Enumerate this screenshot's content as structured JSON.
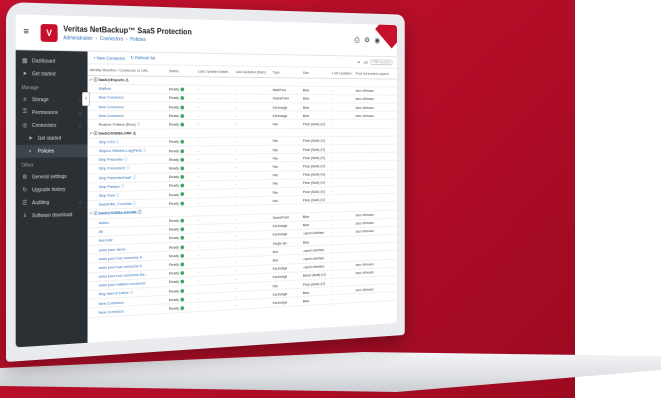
{
  "app": {
    "title": "Veritas NetBackup™ SaaS Protection",
    "breadcrumb": [
      "Administration",
      "Connectors",
      "Policies"
    ],
    "logo_label": "V",
    "colors": {
      "brand": "#c8102e",
      "link": "#2a6db5",
      "ok": "#3aa55d"
    }
  },
  "sidebar": {
    "items": [
      {
        "icon": "dashboard-icon",
        "glyph": "▦",
        "label": "Dashboard"
      },
      {
        "icon": "rocket-icon",
        "glyph": "➤",
        "label": "Get started"
      },
      {
        "icon": "",
        "glyph": "",
        "label": "Manage",
        "section": true
      },
      {
        "icon": "storage-icon",
        "glyph": "≡",
        "label": "Storage"
      },
      {
        "icon": "permissions-icon",
        "glyph": "⚿",
        "label": "Permissions"
      },
      {
        "icon": "connectors-icon",
        "glyph": "◎",
        "label": "Connectors"
      },
      {
        "icon": "rocket-icon",
        "glyph": "➤",
        "label": "Get started",
        "sub": true
      },
      {
        "icon": "policies-icon",
        "glyph": "◐",
        "label": "Policies",
        "sub": true,
        "active": true
      },
      {
        "icon": "",
        "glyph": "",
        "label": "Other",
        "section": true
      },
      {
        "icon": "settings-icon",
        "glyph": "⚙",
        "label": "General settings"
      },
      {
        "icon": "upgrade-icon",
        "glyph": "↻",
        "label": "Upgrade history"
      },
      {
        "icon": "auditing-icon",
        "glyph": "☰",
        "label": "Auditing"
      },
      {
        "icon": "software-icon",
        "glyph": "⤓",
        "label": "Software download"
      }
    ]
  },
  "toolbar": {
    "new_connector": "+ New Connector",
    "refresh": "Refresh list",
    "filter_label": "All",
    "search_placeholder": "Filter by name"
  },
  "table": {
    "headers": [
      "Identity Machine / Connector or URL",
      "Status",
      "Last Updated (date)",
      "Last Updated (stats)",
      "Type",
      "Size",
      "Last Updated",
      "Post Scheduled capture"
    ],
    "rows": [
      {
        "kind": "group",
        "name": "✓ ⓒ SaaS@Exports ⚠"
      },
      {
        "kind": "item",
        "name": "Mailbox",
        "status": "Ready",
        "c3": "-",
        "c4": "-",
        "type": "Mail/Prox",
        "size": "Blue",
        "c7": "-",
        "c8": "sec/-/#/hours"
      },
      {
        "kind": "item",
        "name": "New Connector",
        "status": "Ready",
        "c3": "-",
        "c4": "-",
        "type": "SharePoint",
        "size": "Blue",
        "c7": "-",
        "c8": "sec/-/#/hours"
      },
      {
        "kind": "item",
        "name": "New Connector",
        "status": "Ready",
        "c3": "-",
        "c4": "-",
        "type": "Exchange",
        "size": "Blue",
        "c7": "-",
        "c8": "sec/-/#/hours"
      },
      {
        "kind": "item",
        "name": "New Connector",
        "status": "Ready",
        "c3": "-",
        "c4": "-",
        "type": "Exchange",
        "size": "Blue",
        "c7": "-",
        "c8": "sec/-/#/hours"
      },
      {
        "kind": "item",
        "dark": true,
        "name": "Restore Folders (Root) ⓘ",
        "status": "Ready",
        "c3": "-",
        "c4": "-",
        "type": "File",
        "size": "Price (Bulk) (G)",
        "c7": "-",
        "c8": ""
      },
      {
        "kind": "group",
        "name": "✓ ⓒ SaaS@GIS/Ba.ORK ⚠"
      },
      {
        "kind": "item",
        "name": "Strip OTS ⓘ",
        "status": "Ready",
        "c3": "-",
        "c4": "-",
        "type": "File",
        "size": "Price (Bulk) (G)",
        "c7": "-",
        "c8": ""
      },
      {
        "kind": "item",
        "name": "Strip/Ls Hilfwerk-LargPerls ⓘ",
        "status": "Ready",
        "c3": "-",
        "c4": "-",
        "type": "File",
        "size": "Price (Bulk) (G)",
        "c7": "-",
        "c8": ""
      },
      {
        "kind": "item",
        "name": "Strip Presenter ⓘ",
        "status": "Ready",
        "c3": "-",
        "c4": "-",
        "type": "File",
        "size": "Price (Bulk) (G)",
        "c7": "-",
        "c8": ""
      },
      {
        "kind": "item",
        "name": "Strip Presenter2 ⓘ",
        "status": "Ready",
        "c3": "-",
        "c4": "-",
        "type": "File",
        "size": "Price (Bulk) (G)",
        "c7": "-",
        "c8": ""
      },
      {
        "kind": "item",
        "name": "Strip PresenterDesF ⓘ",
        "status": "Ready",
        "c3": "-",
        "c4": "-",
        "type": "File",
        "size": "Price (Bulk) (G)",
        "c7": "-",
        "c8": ""
      },
      {
        "kind": "item",
        "name": "Strip Presser ⓘ",
        "status": "Ready",
        "c3": "-",
        "c4": "-",
        "type": "File",
        "size": "Price (Bulk) (G)",
        "c7": "-",
        "c8": ""
      },
      {
        "kind": "item",
        "name": "Strip Root ⓘ",
        "status": "Ready",
        "c3": "-",
        "c4": "-",
        "type": "File",
        "size": "Price (Bulk) (G)",
        "c7": "-",
        "c8": ""
      },
      {
        "kind": "item",
        "name": "SaaSFilter_FoxData ⓘ",
        "status": "Ready",
        "c3": "-",
        "c4": "-",
        "type": "File",
        "size": "Price (Bulk) (G)",
        "c7": "-",
        "c8": ""
      },
      {
        "kind": "group",
        "blue": true,
        "name": "✓ ⓒ SaaS@GIS/Ba.NAGRE ⓘ"
      },
      {
        "kind": "item",
        "name": "Admin",
        "status": "Ready",
        "c3": "-",
        "c4": "-",
        "type": "SharePoint",
        "size": "Blue",
        "c7": "-",
        "c8": "sec/-/#/hours"
      },
      {
        "kind": "item",
        "name": "All",
        "status": "Ready",
        "c3": "-",
        "c4": "-",
        "type": "Exchange",
        "size": "Blue",
        "c7": "-",
        "c8": "sec/-/#/hours"
      },
      {
        "kind": "item",
        "name": "Aui-Datz",
        "status": "Ready",
        "c3": "-",
        "c4": "-",
        "type": "Exchange",
        "size": "-user/noNefied",
        "c7": "-",
        "c8": "sec/-/#/hours"
      },
      {
        "kind": "item",
        "name": "antar pour demo",
        "status": "Ready",
        "c3": "-",
        "c4": "-",
        "type": "Single Bu",
        "size": "Blue",
        "c7": "-",
        "c8": ""
      },
      {
        "kind": "item",
        "name": "antar pour bus connector II",
        "status": "Ready",
        "c3": "-",
        "c4": "-",
        "type": "Box",
        "size": "-user/noNefied",
        "c7": "-",
        "c8": ""
      },
      {
        "kind": "item",
        "name": "antar pour bus connector II",
        "status": "Ready",
        "c3": "-",
        "c4": "-",
        "type": "Box",
        "size": "-user/noNefied",
        "c7": "-",
        "c8": ""
      },
      {
        "kind": "item",
        "name": "antar pour bus connector Ba...",
        "status": "Ready",
        "c3": "-",
        "c4": "-",
        "type": "Exchange",
        "size": "-user/noNefied",
        "c7": "-",
        "c8": "sec/-/#/hours"
      },
      {
        "kind": "item",
        "name": "antar pour mailbox connector",
        "status": "Ready",
        "c3": "-",
        "c4": "-",
        "type": "Exchange",
        "size": "Blood (Bulk) (G)",
        "c7": "-",
        "c8": "sec/-/#/hours"
      },
      {
        "kind": "item",
        "name": "Reg Hard 8 Esfers ⓘ",
        "status": "Ready",
        "c3": "-",
        "c4": "-",
        "type": "File",
        "size": "Price (Bulk) (G)",
        "c7": "-",
        "c8": ""
      },
      {
        "kind": "item",
        "name": "New Connector",
        "status": "Ready",
        "c3": "-",
        "c4": "-",
        "type": "Exchange",
        "size": "Blue",
        "c7": "-",
        "c8": "sec/-/#/hours"
      },
      {
        "kind": "item",
        "name": "New Connector",
        "status": "Ready",
        "c3": "-",
        "c4": "-",
        "type": "Exchange",
        "size": "Blue",
        "c7": "-",
        "c8": ""
      }
    ]
  }
}
